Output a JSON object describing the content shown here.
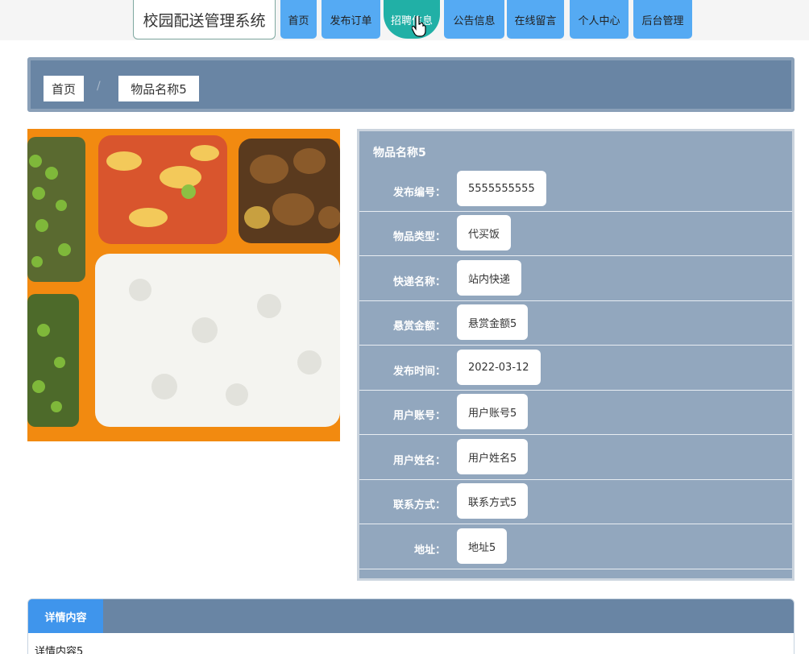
{
  "site": {
    "title": "校园配送管理系统"
  },
  "nav": {
    "items": [
      {
        "label": "首页"
      },
      {
        "label": "发布订单"
      },
      {
        "label": "招聘信息"
      },
      {
        "label": "公告信息"
      },
      {
        "label": "在线留言"
      },
      {
        "label": "个人中心"
      },
      {
        "label": "后台管理"
      }
    ],
    "active_index": 2
  },
  "breadcrumb": {
    "home": "首页",
    "separator": "/",
    "current": "物品名称5"
  },
  "detail": {
    "title": "物品名称5",
    "fields": [
      {
        "label": "发布编号：",
        "value": "5555555555"
      },
      {
        "label": "物品类型：",
        "value": "代买饭"
      },
      {
        "label": "快递名称：",
        "value": "站内快递"
      },
      {
        "label": "悬赏金额：",
        "value": "悬赏金额5"
      },
      {
        "label": "发布时间：",
        "value": "2022-03-12"
      },
      {
        "label": "用户账号：",
        "value": "用户账号5"
      },
      {
        "label": "用户姓名：",
        "value": "用户姓名5"
      },
      {
        "label": "联系方式：",
        "value": "联系方式5"
      },
      {
        "label": "地址：",
        "value": "地址5"
      }
    ]
  },
  "content": {
    "tab_label": "详情内容",
    "text": "详情内容5"
  },
  "colors": {
    "nav": "#55aaf3",
    "nav_active": "#21b0a6",
    "panel": "#92a7be",
    "header_bar": "#6985a4",
    "tab_active": "#3f95ec"
  }
}
